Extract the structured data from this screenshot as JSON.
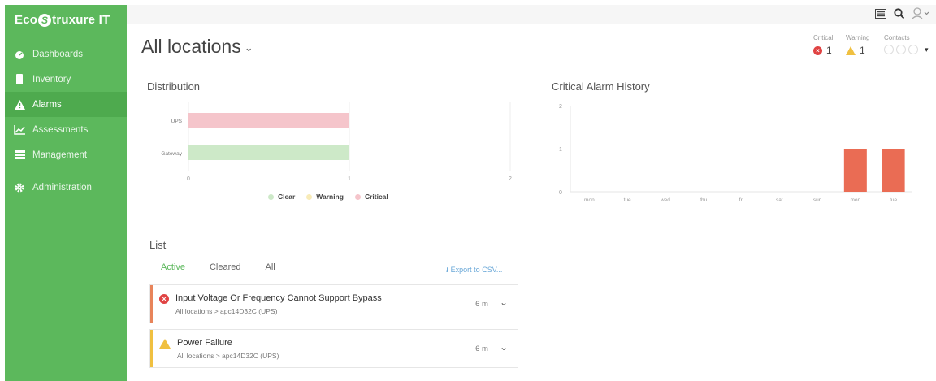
{
  "app": {
    "logo_text_left": "Eco",
    "logo_text_right": "truxure IT"
  },
  "sidebar": {
    "items": [
      {
        "label": "Dashboards",
        "icon": "dashboard-icon"
      },
      {
        "label": "Inventory",
        "icon": "inventory-icon"
      },
      {
        "label": "Alarms",
        "icon": "alarm-triangle-icon",
        "active": true
      },
      {
        "label": "Assessments",
        "icon": "chart-line-icon"
      },
      {
        "label": "Management",
        "icon": "management-icon"
      },
      {
        "label": "Administration",
        "icon": "gear-icon"
      }
    ]
  },
  "header": {
    "title": "All locations",
    "status": {
      "critical_label": "Critical",
      "critical_value": "1",
      "warning_label": "Warning",
      "warning_value": "1",
      "contacts_label": "Contacts"
    }
  },
  "distribution": {
    "title": "Distribution",
    "legend": [
      {
        "label": "Clear",
        "color": "#cde9c8"
      },
      {
        "label": "Warning",
        "color": "#f8ebb8"
      },
      {
        "label": "Critical",
        "color": "#f5c5cb"
      }
    ]
  },
  "alarm_history": {
    "title": "Critical Alarm History"
  },
  "list": {
    "title": "List",
    "tabs": [
      "Active",
      "Cleared",
      "All"
    ],
    "export_label": "Export to CSV...",
    "alarms": [
      {
        "severity": "critical",
        "title": "Input Voltage Or Frequency Cannot Support Bypass",
        "path": "All locations > apc14D32C (UPS)",
        "time": "6 m"
      },
      {
        "severity": "warning",
        "title": "Power Failure",
        "path": "All locations > apc14D32C (UPS)",
        "time": "6 m"
      }
    ]
  },
  "chart_data": [
    {
      "type": "bar",
      "orientation": "horizontal",
      "title": "Distribution",
      "categories": [
        "UPS",
        "Gateway"
      ],
      "series": [
        {
          "name": "Clear",
          "values": [
            0,
            1
          ],
          "color": "#cde9c8"
        },
        {
          "name": "Warning",
          "values": [
            0,
            0
          ],
          "color": "#f8ebb8"
        },
        {
          "name": "Critical",
          "values": [
            1,
            0
          ],
          "color": "#f5c5cb"
        }
      ],
      "xticks": [
        "0",
        "1",
        "2"
      ],
      "xlim": [
        0,
        2
      ]
    },
    {
      "type": "bar",
      "title": "Critical Alarm History",
      "categories": [
        "mon",
        "tue",
        "wed",
        "thu",
        "fri",
        "sat",
        "sun",
        "mon",
        "tue"
      ],
      "values": [
        0,
        0,
        0,
        0,
        0,
        0,
        0,
        1,
        1
      ],
      "yticks": [
        "0",
        "1",
        "2"
      ],
      "ylim": [
        0,
        2
      ],
      "color": "#ea6c54"
    }
  ]
}
